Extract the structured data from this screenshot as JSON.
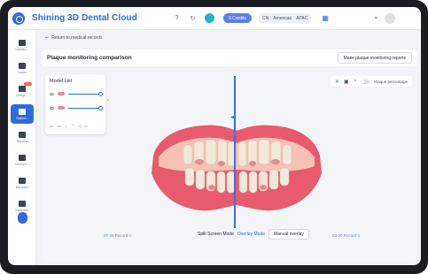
{
  "app": {
    "title": "Shining 3D Dental Cloud",
    "credits": "0 Credits",
    "region": {
      "country": "CN",
      "area": "Americas",
      "zone": "APAC"
    }
  },
  "sidebar": {
    "items": [
      {
        "label": "Dashbo...",
        "icon": "bar-chart-icon"
      },
      {
        "label": "Cases",
        "icon": "home-icon"
      },
      {
        "label": "Design...",
        "icon": "design-icon"
      },
      {
        "label": "Patient...",
        "icon": "user-icon",
        "active": true
      },
      {
        "label": "Reports",
        "icon": "report-icon"
      },
      {
        "label": "Connect...",
        "icon": "connect-icon"
      },
      {
        "label": "Members",
        "icon": "members-icon"
      },
      {
        "label": "Institution",
        "icon": "institution-icon"
      }
    ]
  },
  "breadcrumb": {
    "back_label": "Return to medical records"
  },
  "header": {
    "title": "Plaque monitoring comparison",
    "report_button": "Make plaque monitoring reports"
  },
  "model_list": {
    "title": "Model List"
  },
  "view_tools": {
    "plaque_label": "Plaque percentage"
  },
  "records": {
    "left": "07-25 Record-1",
    "right": "03-20 Record-1"
  },
  "modes": {
    "split": "Split Screen Mode",
    "overlay": "Overlay Mode",
    "manual": "Manual overlay"
  },
  "colors": {
    "accent": "#2f6bdc",
    "gum": "#e85a6e",
    "tooth": "#f3e8da"
  }
}
